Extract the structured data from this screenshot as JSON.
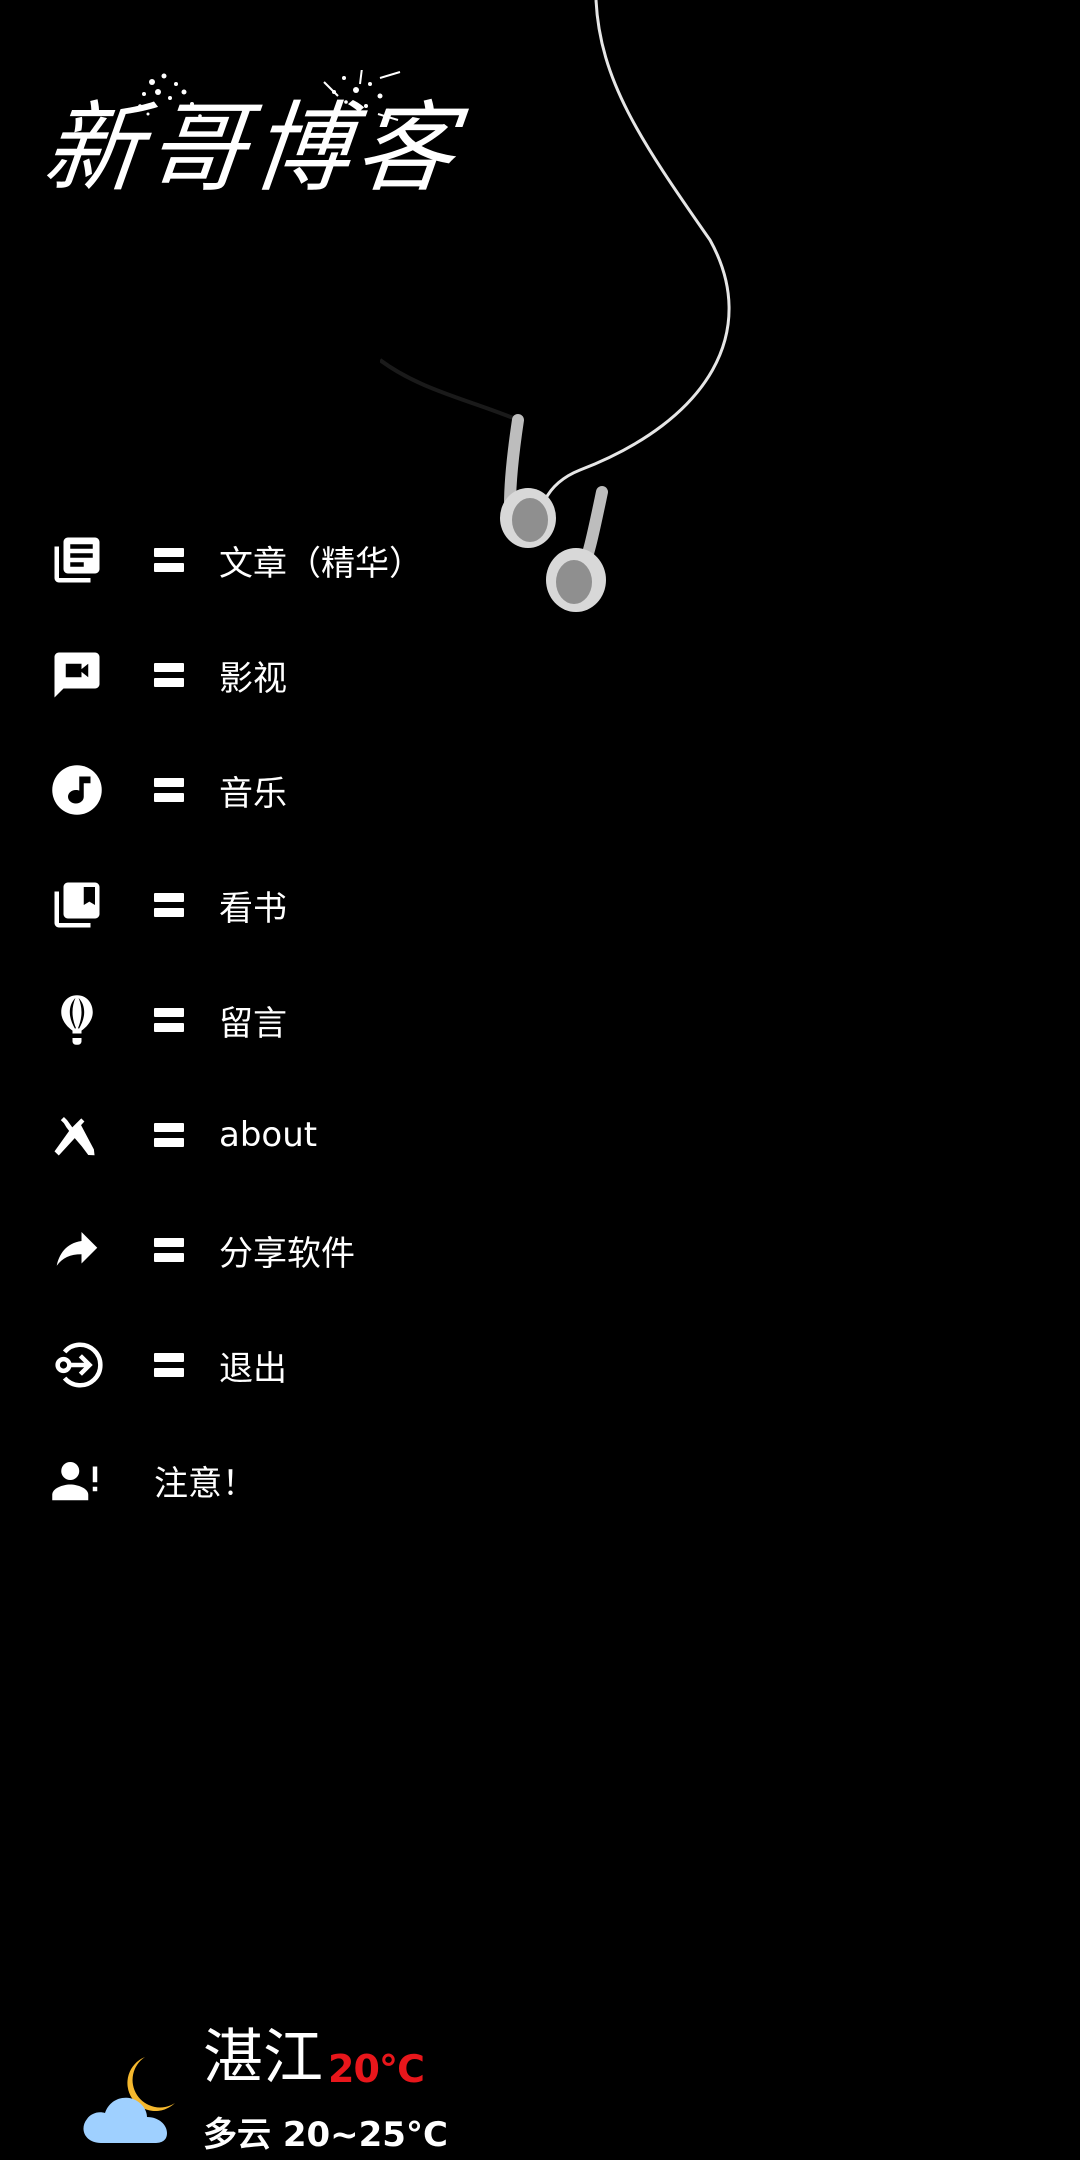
{
  "header": {
    "logo_text": "新哥博客"
  },
  "menu": {
    "items": [
      {
        "icon": "article-icon",
        "label": "文章（精华）"
      },
      {
        "icon": "video-chat-icon",
        "label": "影视"
      },
      {
        "icon": "music-note-icon",
        "label": "音乐"
      },
      {
        "icon": "library-book-icon",
        "label": "看书"
      },
      {
        "icon": "hot-air-balloon-icon",
        "label": "留言"
      },
      {
        "icon": "tools-icon",
        "label": "about"
      },
      {
        "icon": "share-arrow-icon",
        "label": "分享软件"
      },
      {
        "icon": "logout-icon",
        "label": "退出"
      },
      {
        "icon": "user-alert-icon",
        "label": "注意！"
      }
    ]
  },
  "weather": {
    "icon": "partly-cloudy-night-icon",
    "city": "湛江",
    "temperature": "20℃",
    "description": "多云 20~25°C"
  },
  "colors": {
    "background": "#000000",
    "text": "#ffffff",
    "temperature": "#e8161b",
    "cloud": "#9fd0ff",
    "moon": "#f5b82e"
  }
}
